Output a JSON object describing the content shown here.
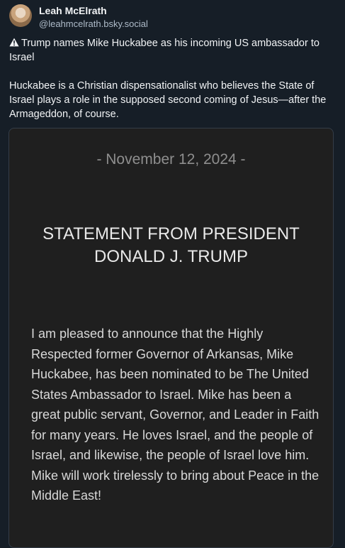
{
  "author": {
    "display_name": "Leah McElrath",
    "handle": "@leahmcelrath.bsky.social"
  },
  "post": {
    "icon": "warning-icon",
    "paragraph1": "Trump names Mike Huckabee as his incoming US ambassador to Israel",
    "paragraph2": "Huckabee is a Christian dispensationalist who believes the State of Israel plays a role in the supposed second coming of Jesus—after the Armageddon, of course."
  },
  "embed": {
    "date": "- November 12, 2024 -",
    "heading": "STATEMENT FROM PRESIDENT DONALD J. TRUMP",
    "body": "I am pleased to announce that the Highly Respected former Governor of Arkansas, Mike Huckabee, has been nominated to be The United States Ambassador to Israel. Mike has been a great public servant, Governor, and Leader in Faith for many years. He loves Israel, and the people of Israel, and likewise, the people of Israel love him. Mike will work tirelessly to bring about Peace in the Middle East!"
  },
  "colors": {
    "background": "#161e27",
    "embed_background": "#1f1f1f",
    "text": "#f1f3f5",
    "handle": "#aebbc9",
    "date": "#8e8e8e"
  }
}
